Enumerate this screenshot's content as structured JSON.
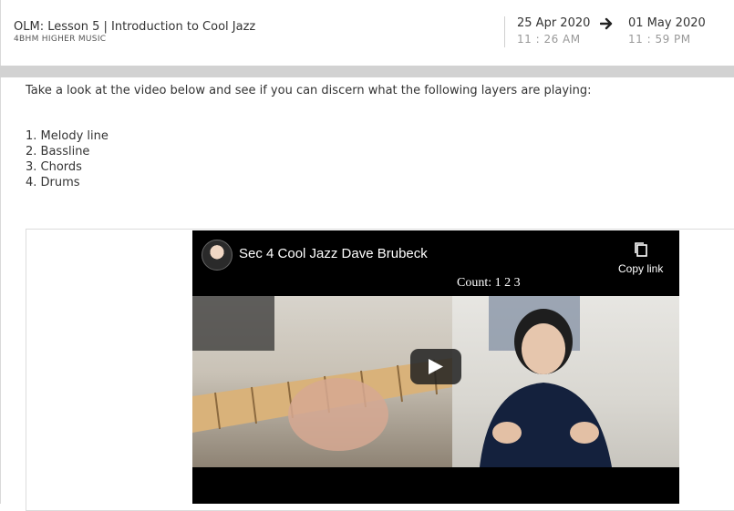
{
  "header": {
    "title": "OLM: Lesson 5 | Introduction to Cool Jazz",
    "class_code": "4BHM HIGHER MUSIC",
    "start_date": "25 Apr 2020",
    "start_time": "11 : 26 AM",
    "end_date": "01 May 2020",
    "end_time": "11 : 59 PM",
    "arrow_icon": "arrow-right-icon"
  },
  "content": {
    "intro": "Take a look at the video below and see if you can discern what the following layers are playing:",
    "layers": [
      "1. Melody line",
      "2. Bassline",
      "3. Chords",
      "4. Drums"
    ]
  },
  "video": {
    "title": "Sec 4 Cool Jazz Dave Brubeck",
    "copy_link_label": "Copy link",
    "count_text": "Count: 1  2  3",
    "copy_icon": "copy-icon",
    "play_icon": "play-icon"
  }
}
